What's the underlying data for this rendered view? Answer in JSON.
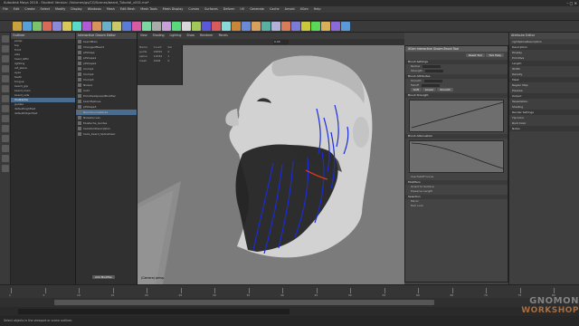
{
  "window": {
    "title": "Autodesk Maya 2016 - Student Version: /Volumes/gs/CG/Scenes/beard_Tutorial_v001.ma*",
    "controls": "– ▢ ✕"
  },
  "menubar": [
    "File",
    "Edit",
    "Create",
    "Select",
    "Modify",
    "Display",
    "Windows",
    "Mesh",
    "Edit Mesh",
    "Mesh Tools",
    "Mesh Display",
    "Curves",
    "Surfaces",
    "Deform",
    "UV",
    "Generate",
    "Cache",
    "Arnold",
    "XGen",
    "Help"
  ],
  "outliner": {
    "header": "Outliner",
    "rows": [
      "persp",
      "top",
      "front",
      "side",
      "head_GEO",
      "lighting",
      "ref_plane",
      "eyes",
      "teeth",
      "tongue",
      "beard_grp",
      "beard_main",
      "beard_side",
      "mustache",
      "guides",
      "defaultLightSet",
      "defaultObjectSet"
    ],
    "selected_index": 13
  },
  "editor": {
    "header": "Interactive Groom Editor",
    "rows": [
      "beardMain",
      "ChangeofBeard",
      "ptShape",
      "ptShape1",
      "ptShape2",
      "Clump1",
      "Clump2",
      "Clump3",
      "Noise1",
      "Cut1",
      "PrimitiveSpreadModifier",
      "beardSplines",
      "ptShape3",
      "BeardCurvesNode",
      "NoiseCurves",
      "Mustache_Guides",
      "hairsSimDescription",
      "hairs_beard_SplineDesc"
    ],
    "selected_index": 13,
    "footer_button": "Add Modifier"
  },
  "channelbox": {
    "rows": [
      {
        "a": "Name",
        "b": "Count",
        "c": "Sel"
      },
      {
        "a": "guide",
        "b": "28450",
        "c": "0"
      },
      {
        "a": "spline",
        "b": "12034",
        "c": "1"
      },
      {
        "a": "mesh",
        "b": "4408",
        "c": "0"
      }
    ]
  },
  "viewport": {
    "menu": [
      "View",
      "Shading",
      "Lighting",
      "Show",
      "Renderer",
      "Panels"
    ],
    "camera_label": "(Camera) persp",
    "field_value": "0.00"
  },
  "dialog": {
    "title": "XGen Interactive Groom Brush Tool",
    "buttons": [
      "Reset Tool",
      "Tool Help"
    ],
    "sections": [
      "Brush Settings",
      "Brush Attributes",
      "Affect",
      "Falloff",
      "Shape",
      "Smooth",
      "Brush Strength",
      "Brush Attenuation",
      "Modifiers",
      "Selection"
    ],
    "rows": [
      "Radius",
      "Strength",
      "Smooth",
      "Falloff",
      "Soft",
      "Linear",
      "Smooth",
      "Use Falloff Curve",
      "Orient to Surface",
      "Preserve Length",
      "Mirror",
      "Hair Lock"
    ]
  },
  "attr_editor": {
    "header": "Attribute Editor",
    "rows": [
      "xgmSplineDescription",
      "Description",
      "Display",
      "Primitive",
      "Length",
      "Width",
      "Density",
      "Mask",
      "Region Map",
      "Preview",
      "Output",
      "Tessellation",
      "Shading",
      "Render Settings",
      "Tip Color",
      "Root Color",
      "Notes"
    ]
  },
  "timeline": {
    "ticks": [
      "1",
      "5",
      "10",
      "15",
      "20",
      "25",
      "30",
      "35",
      "40",
      "45",
      "50",
      "55",
      "60",
      "65",
      "70",
      "75",
      "80"
    ],
    "current_frame": "1"
  },
  "helpline": "Select objects in the viewport or scene outliner.",
  "watermark": {
    "line1": "GNOMON",
    "line2": "WORKSHOP"
  },
  "colors": {
    "selection": "#4a6c8f",
    "guide_blue": "#1a2cd8",
    "highlight_red": "#d83a1a"
  }
}
